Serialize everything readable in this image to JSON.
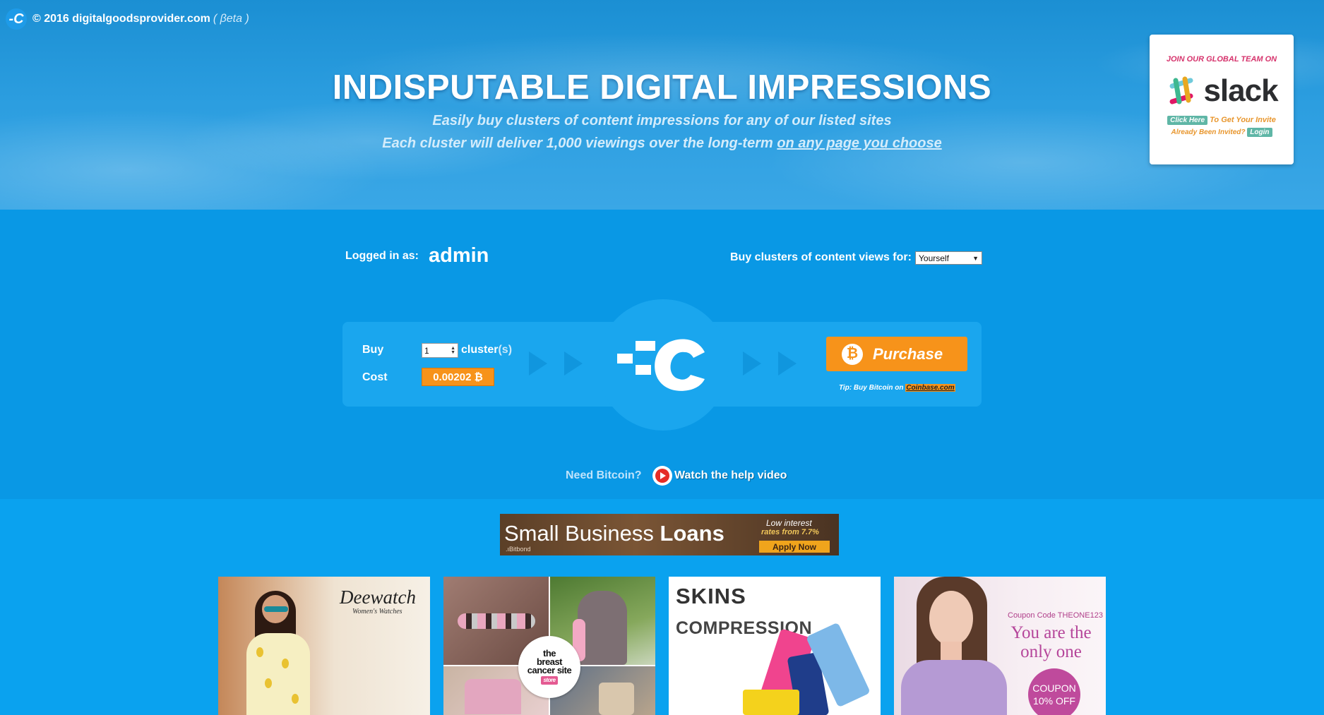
{
  "header": {
    "brand_text": "© 2016 digitalgoodsprovider.com",
    "beta_label": "( βeta )",
    "logo_icon": "dgp-logo-icon"
  },
  "hero": {
    "title": "INDISPUTABLE DIGITAL IMPRESSIONS",
    "subtitle_1": "Easily buy clusters of content impressions for any of our listed sites",
    "subtitle_2_prefix": "Each cluster will deliver 1,000 viewings over the long-term ",
    "subtitle_2_link": "on any page you choose"
  },
  "slack_card": {
    "join_text": "JOIN OUR GLOBAL TEAM ON",
    "wordmark": "slack",
    "click_here": "Click Here",
    "invite_text": "To Get Your Invite",
    "already_invited": "Already Been Invited?",
    "login": "Login"
  },
  "account": {
    "logged_in_label": "Logged in as:",
    "username": "admin",
    "buy_for_label": "Buy clusters of content views for:",
    "buy_for_selected": "Yourself"
  },
  "order": {
    "buy_label": "Buy",
    "quantity": "1",
    "cluster_label": "cluster",
    "cluster_suffix": "(s)",
    "cost_label": "Cost",
    "cost_value": "0.00202 ₿",
    "purchase_label": "Purchase",
    "tip_text": "Tip: Buy Bitcoin on ",
    "tip_link": "Coinbase.com"
  },
  "help": {
    "need_bitcoin": "Need Bitcoin?",
    "watch_video": "Watch the help video"
  },
  "ads": {
    "banner": {
      "title_light": "Small Business ",
      "title_bold": "Loans",
      "brand": ".ıBitbond",
      "rate_line1": "Low interest",
      "rate_line2": "rates from 7.7%",
      "apply": "Apply Now"
    },
    "tiles": [
      {
        "brand": "Deewatch",
        "subtitle": "Women's Watches"
      },
      {
        "badge_line1": "the",
        "badge_line2": "breast",
        "badge_line3": "cancer site",
        "badge_store": "store"
      },
      {
        "brand": "SKINS",
        "headline": "COMPRESSION"
      },
      {
        "code": "Coupon Code THEONE123",
        "headline": "You are the only one",
        "coupon_line1": "COUPON",
        "coupon_line2": "10% OFF"
      }
    ]
  },
  "colors": {
    "background": "#0aa2ef",
    "panel": "#1aa6ee",
    "bitcoin_orange": "#f7931a"
  }
}
